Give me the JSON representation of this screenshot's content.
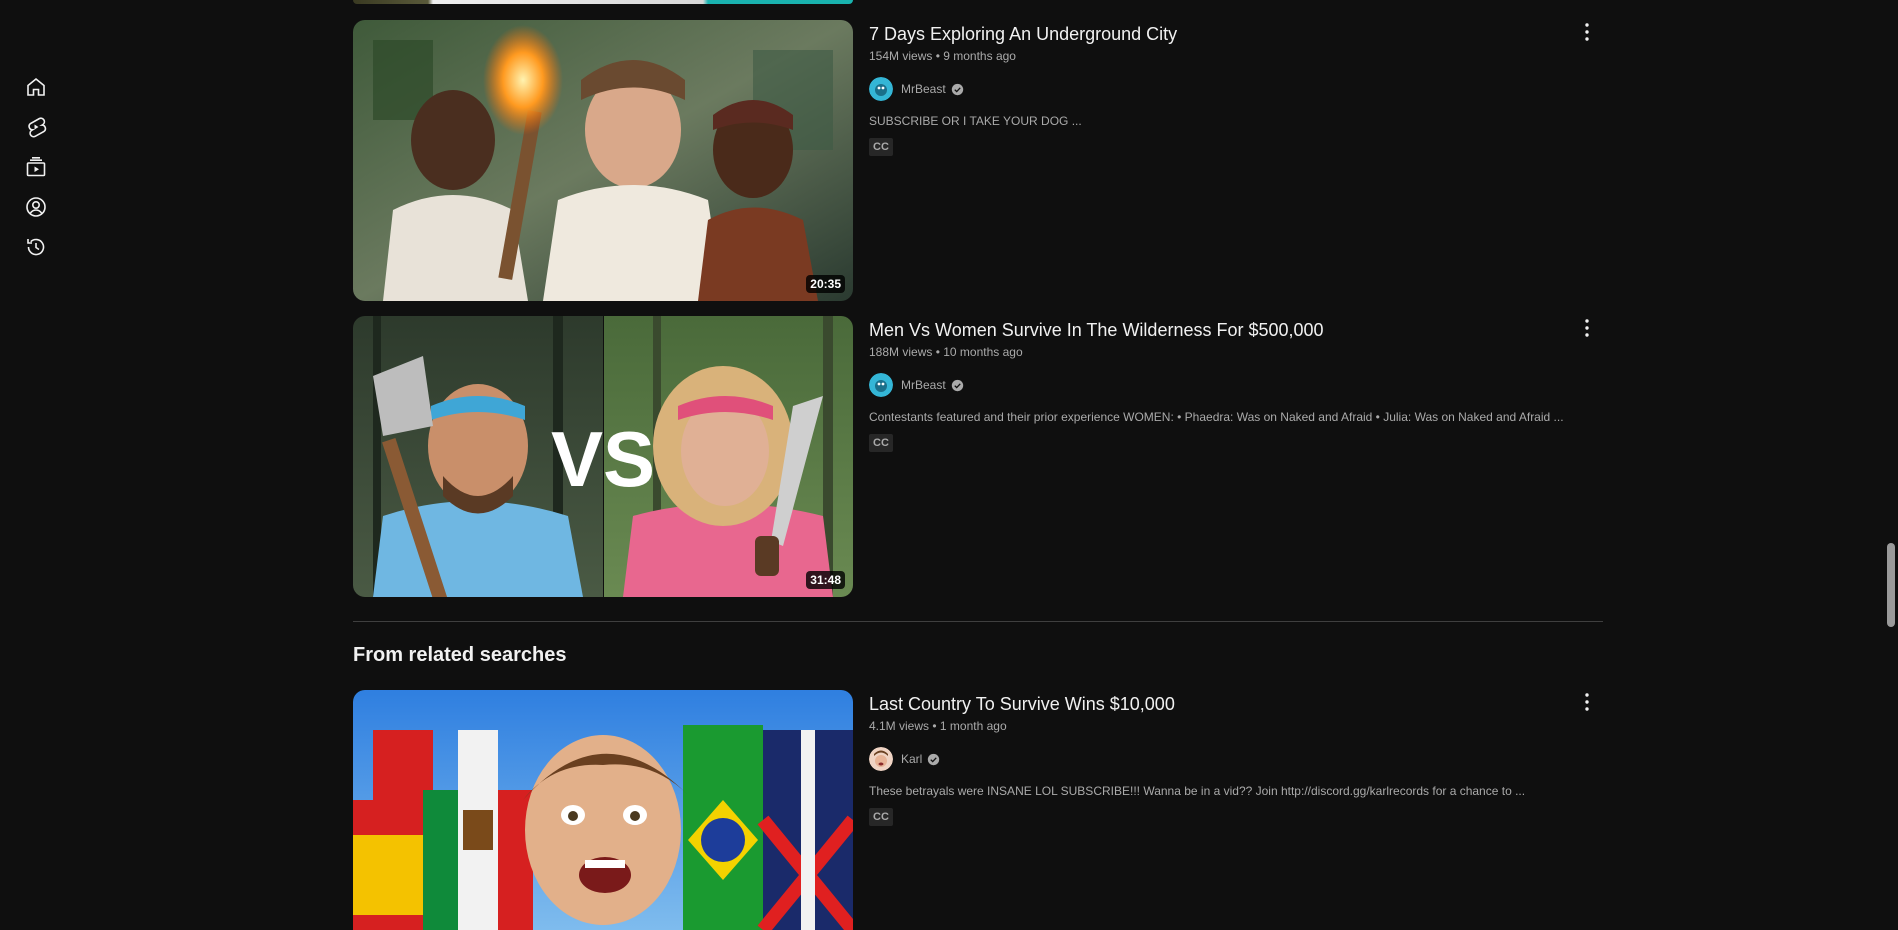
{
  "sidebar": {
    "items": [
      {
        "icon": "home-icon"
      },
      {
        "icon": "shorts-icon"
      },
      {
        "icon": "subscriptions-icon"
      },
      {
        "icon": "you-icon"
      },
      {
        "icon": "history-icon"
      }
    ]
  },
  "videos": [
    {
      "title": "7 Days Exploring An Underground City",
      "views": "154M views",
      "age": "9 months ago",
      "channel": "MrBeast",
      "description": "SUBSCRIBE OR I TAKE YOUR DOG ...",
      "cc": "CC",
      "duration": "20:35"
    },
    {
      "title": "Men Vs Women Survive In The Wilderness For $500,000",
      "views": "188M views",
      "age": "10 months ago",
      "channel": "MrBeast",
      "description": "Contestants featured and their prior experience WOMEN: • Phaedra: Was on Naked and Afraid • Julia: Was on Naked and Afraid ...",
      "cc": "CC",
      "duration": "31:48",
      "vs_text": "VS"
    }
  ],
  "related": {
    "heading": "From related searches",
    "videos": [
      {
        "title": "Last Country To Survive Wins $10,000",
        "views": "4.1M views",
        "age": "1 month ago",
        "channel": "Karl",
        "description": "These betrayals were INSANE LOL SUBSCRIBE!!! Wanna be in a vid?? Join http://discord.gg/karlrecords for a chance to ...",
        "cc": "CC"
      }
    ]
  },
  "meta_separator": "•",
  "colors": {
    "background": "#0f0f0f",
    "text_primary": "#f1f1f1",
    "text_secondary": "#aaaaaa",
    "cc_badge": "#272727"
  }
}
